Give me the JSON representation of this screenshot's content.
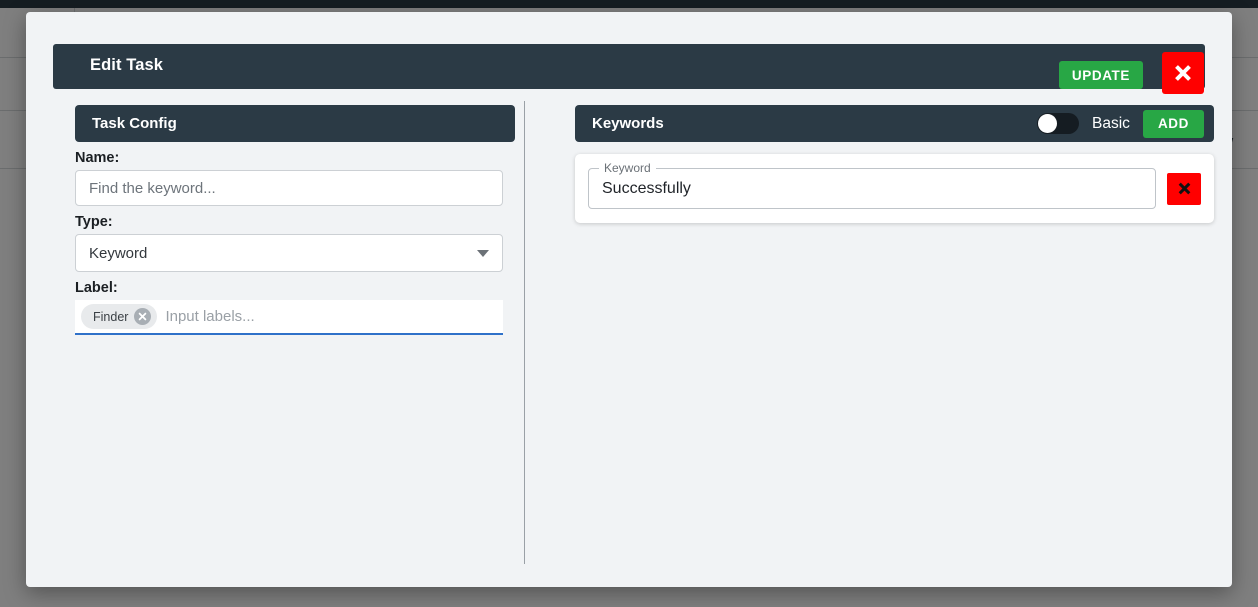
{
  "background": {
    "clipped_text": "ow"
  },
  "modal": {
    "title": "Edit Task",
    "update_label": "UPDATE",
    "close_icon": "close-icon"
  },
  "task_config": {
    "heading": "Task Config",
    "name": {
      "label": "Name:",
      "value": "",
      "placeholder": "Find the keyword..."
    },
    "type": {
      "label": "Type:",
      "value": "Keyword",
      "options": [
        "Keyword"
      ],
      "caret_icon": "chevron-down-icon"
    },
    "labels": {
      "label": "Label:",
      "chips": [
        "Finder"
      ],
      "chip_remove_icon": "circle-close-icon",
      "input_value": "",
      "placeholder": "Input labels..."
    }
  },
  "keywords": {
    "heading": "Keywords",
    "toggle": {
      "label": "Basic",
      "state": "off"
    },
    "add_label": "ADD",
    "field_legend": "Keyword",
    "items": [
      {
        "value": "Successfully",
        "delete_icon": "close-icon"
      }
    ]
  },
  "colors": {
    "header_dark": "#2b3a45",
    "accent_green": "#28a745",
    "danger_red": "#ff0000",
    "focus_blue": "#2f71c9",
    "body_bg": "#f1f3f5"
  }
}
